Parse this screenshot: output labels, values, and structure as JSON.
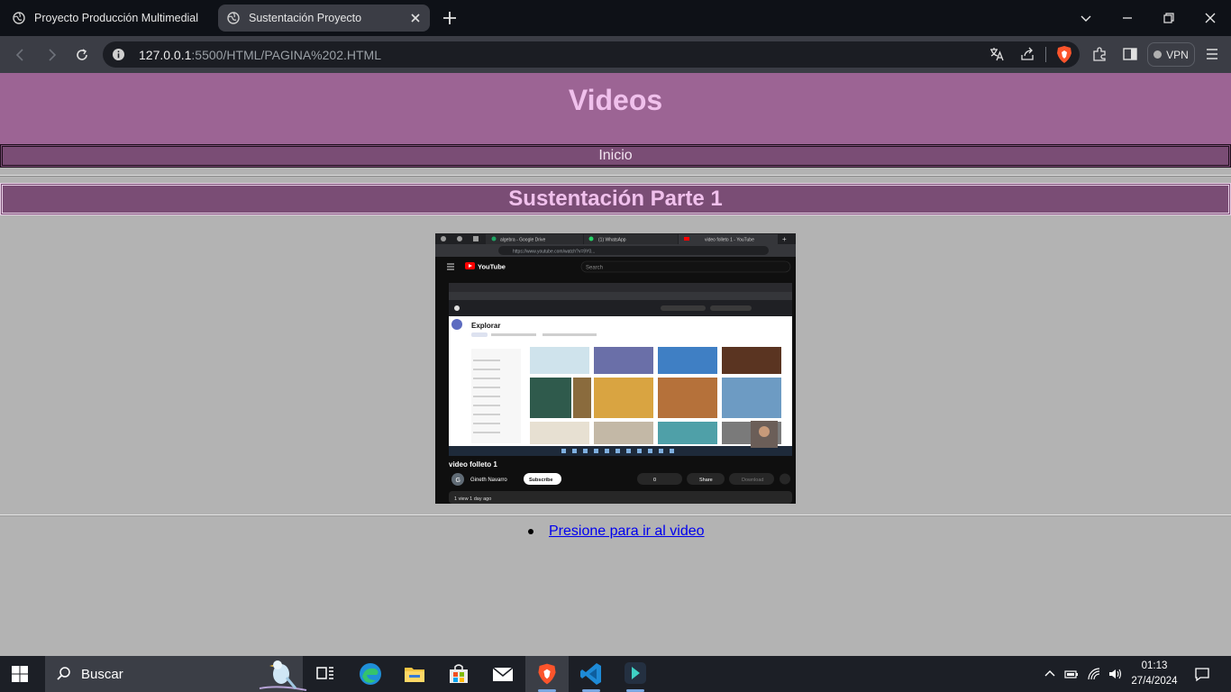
{
  "browser": {
    "tabs": [
      {
        "title": "Proyecto Producción Multimedial"
      },
      {
        "title": "Sustentación Proyecto"
      }
    ],
    "url_host": "127.0.0.1",
    "url_path": ":5500/HTML/PAGINA%202.HTML",
    "vpn_label": "VPN"
  },
  "page": {
    "title": "Videos",
    "nav_link": "Inicio",
    "section_title": "Sustentación Parte 1",
    "video_link": "Presione para ir al video"
  },
  "thumbnail": {
    "tabs": [
      "algebra - Google Drive",
      "(1) WhatsApp",
      "video folleto 1 - YouTube"
    ],
    "url": "https://www.youtube.com/watch?v=9Y0...",
    "brand": "YouTube",
    "search_placeholder": "Search",
    "inner_heading": "Explorar",
    "video_title": "video folleto 1",
    "channel_initial": "G",
    "channel": "Gineth Navarro",
    "subscribe": "Subscribe",
    "likes": "0",
    "share": "Share",
    "download": "Download",
    "meta": "1 view  1 day ago"
  },
  "taskbar": {
    "search_placeholder": "Buscar",
    "time": "01:13",
    "date": "27/4/2024"
  },
  "colors": {
    "header_bg": "#9c6494",
    "nav_bg": "#7a4d75",
    "title_text": "#f0c0ec",
    "page_bg": "#b3b3b3"
  }
}
